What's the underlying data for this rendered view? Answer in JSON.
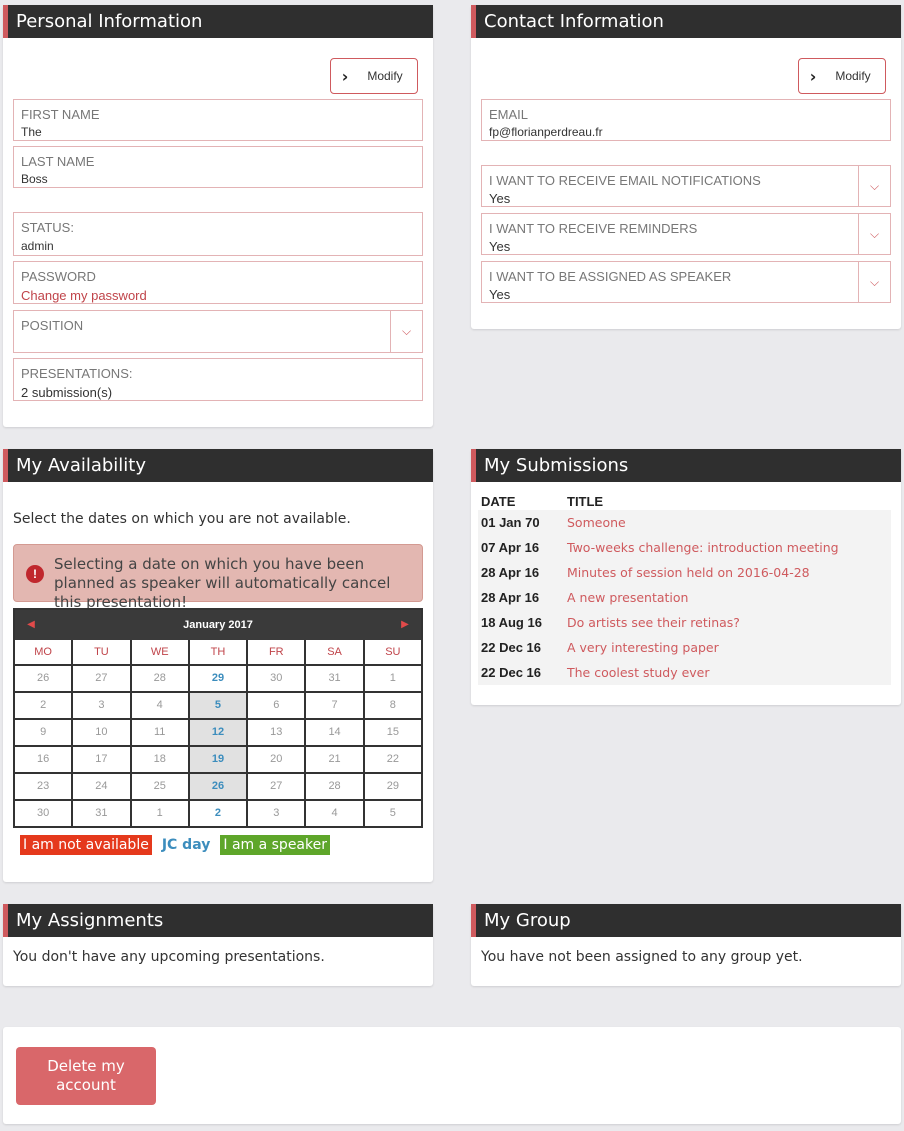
{
  "personal": {
    "title": "Personal Information",
    "modify_label": "Modify",
    "first_name_label": "FIRST NAME",
    "first_name_value": "The",
    "last_name_label": "LAST NAME",
    "last_name_value": "Boss",
    "status_label": "STATUS:",
    "status_value": "admin",
    "password_label": "PASSWORD",
    "password_link": "Change my password",
    "position_label": "POSITION",
    "position_value": "",
    "presentations_label": "PRESENTATIONS:",
    "presentations_value": "2 submission(s)"
  },
  "contact": {
    "title": "Contact Information",
    "modify_label": "Modify",
    "email_label": "EMAIL",
    "email_value": "fp@florianperdreau.fr",
    "notify_label": "I WANT TO RECEIVE EMAIL NOTIFICATIONS",
    "notify_value": "Yes",
    "reminders_label": "I WANT TO RECEIVE REMINDERS",
    "reminders_value": "Yes",
    "speaker_label": "I WANT TO BE ASSIGNED AS SPEAKER",
    "speaker_value": "Yes"
  },
  "availability": {
    "title": "My Availability",
    "instructions": "Select the dates on which you are not available.",
    "alert": "Selecting a date on which you have been planned as speaker will automatically cancel this presentation!",
    "calendar": {
      "month": "January 2017",
      "weekdays": [
        "MO",
        "TU",
        "WE",
        "TH",
        "FR",
        "SA",
        "SU"
      ],
      "weeks": [
        [
          "26",
          "27",
          "28",
          "29",
          "30",
          "31",
          "1"
        ],
        [
          "2",
          "3",
          "4",
          "5",
          "6",
          "7",
          "8"
        ],
        [
          "9",
          "10",
          "11",
          "12",
          "13",
          "14",
          "15"
        ],
        [
          "16",
          "17",
          "18",
          "19",
          "20",
          "21",
          "22"
        ],
        [
          "23",
          "24",
          "25",
          "26",
          "27",
          "28",
          "29"
        ],
        [
          "30",
          "31",
          "1",
          "2",
          "3",
          "4",
          "5"
        ]
      ],
      "jc_column": 3
    },
    "legend": {
      "not_available": "I am not available",
      "jc_day": "JC day",
      "speaker": "I am a speaker"
    }
  },
  "submissions": {
    "title": "My Submissions",
    "col_date": "DATE",
    "col_title": "TITLE",
    "rows": [
      {
        "date": "01 Jan 70",
        "title": "Someone"
      },
      {
        "date": "07 Apr 16",
        "title": "Two-weeks challenge: introduction meeting"
      },
      {
        "date": "28 Apr 16",
        "title": "Minutes of session held on 2016-04-28"
      },
      {
        "date": "28 Apr 16",
        "title": "A new presentation"
      },
      {
        "date": "18 Aug 16",
        "title": "Do artists see their retinas?"
      },
      {
        "date": "22 Dec 16",
        "title": "A very interesting paper"
      },
      {
        "date": "22 Dec 16",
        "title": "The coolest study ever"
      }
    ]
  },
  "assignments": {
    "title": "My Assignments",
    "text": "You don't have any upcoming presentations."
  },
  "group": {
    "title": "My Group",
    "text": "You have not been assigned to any group yet."
  },
  "account": {
    "delete_label": "Delete my account"
  },
  "colors": {
    "accent": "#cf5a5e",
    "header_bg": "#2f2f2f",
    "not_available": "#e5391c",
    "jc_day": "#3c8dbd",
    "speaker": "#5ea62a"
  }
}
